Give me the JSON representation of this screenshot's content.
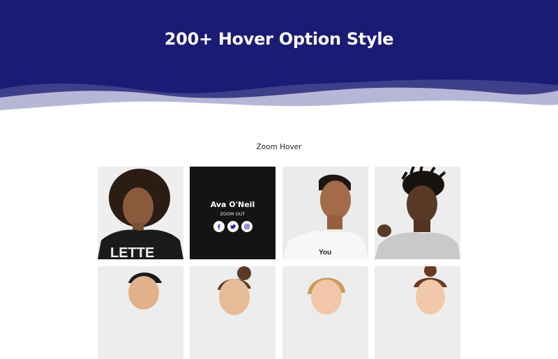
{
  "hero": {
    "title": "200+ Hover Option Style"
  },
  "section": {
    "heading": "Zoom Hover"
  },
  "colors": {
    "hero_bg": "#1a1b74",
    "icon_fg": "#2b1fa8",
    "tile_dark": "#141414"
  },
  "featured": {
    "name": "Ava O'Neil",
    "subtitle": "ZOOM OUT",
    "socials": [
      "facebook-icon",
      "twitter-icon",
      "instagram-icon"
    ]
  },
  "tiles": [
    {
      "row": 1,
      "kind": "photo",
      "subject": "woman with curly hair"
    },
    {
      "row": 1,
      "kind": "hover-overlay"
    },
    {
      "row": 1,
      "kind": "photo",
      "subject": "young man"
    },
    {
      "row": 1,
      "kind": "photo",
      "subject": "man with twists"
    },
    {
      "row": 2,
      "kind": "photo",
      "subject": "person in cap"
    },
    {
      "row": 2,
      "kind": "photo",
      "subject": "woman with bun"
    },
    {
      "row": 2,
      "kind": "photo",
      "subject": "blonde woman"
    },
    {
      "row": 2,
      "kind": "photo",
      "subject": "woman with top bun"
    }
  ]
}
